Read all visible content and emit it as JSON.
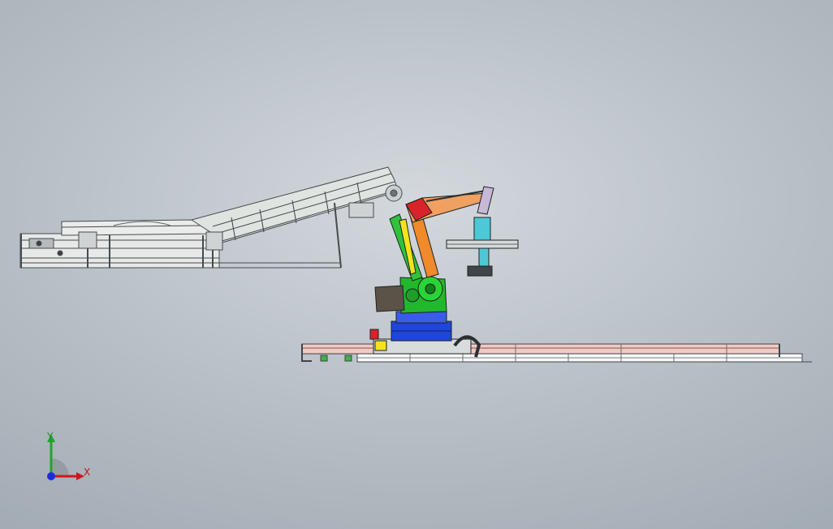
{
  "viewport": {
    "background": "#c6ccd2",
    "accent_colors": {
      "conveyor": "#dfe3e1",
      "robot_base": "#2046d8",
      "robot_body": "#22b82c",
      "robot_arm": "#f08a2a",
      "robot_head": "#d8232a",
      "gripper": "#4ec8d6",
      "track_rail": "#f2c9c3"
    }
  },
  "triad": {
    "x_label": "X",
    "y_label": "Y",
    "x_color": "#d4141c",
    "y_color": "#22a32e",
    "z_color": "#1c2ce0"
  }
}
